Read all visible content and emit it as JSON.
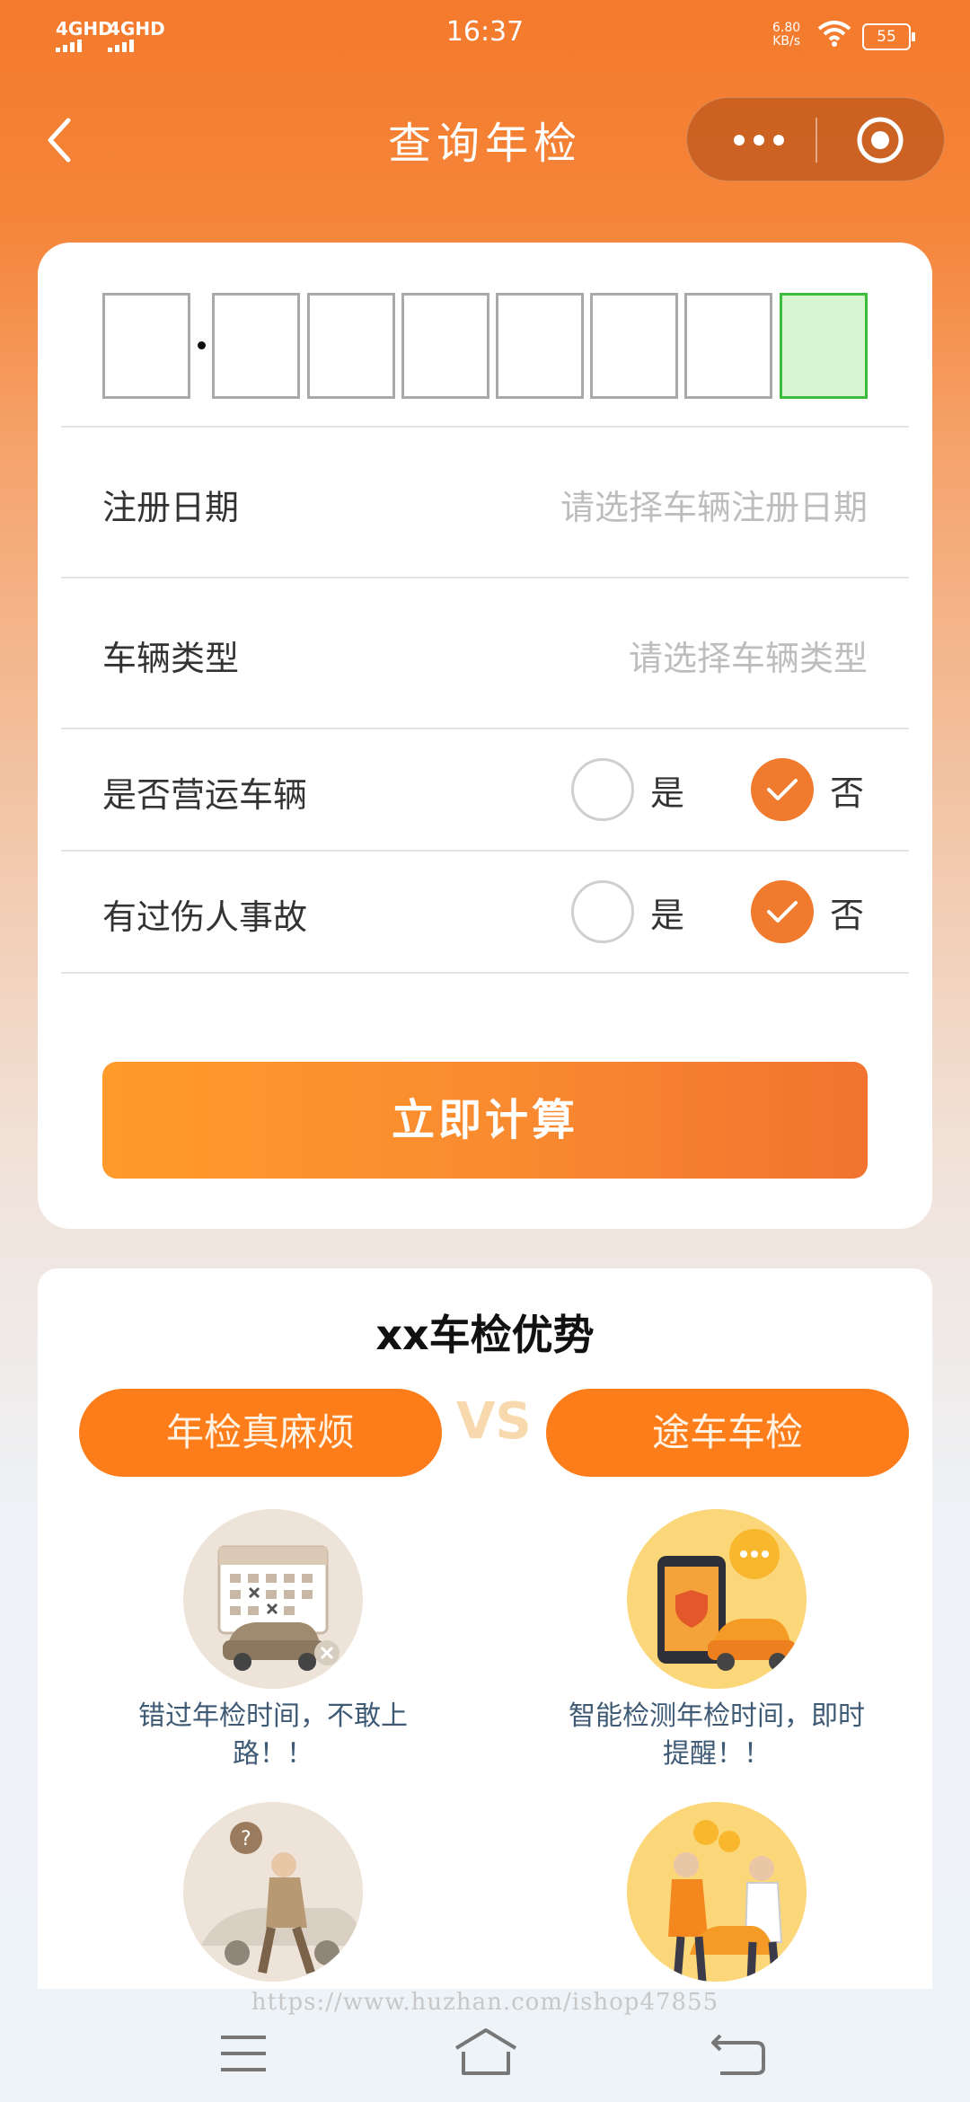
{
  "status_bar": {
    "signal_1": "4GHD",
    "signal_2": "4GHD",
    "time": "16:37",
    "net_speed_value": "6.80",
    "net_speed_unit": "KB/s",
    "battery": "55"
  },
  "nav": {
    "title": "查询年检"
  },
  "plate": {
    "box_count": 8,
    "highlight_index": 7
  },
  "form": {
    "reg_date": {
      "label": "注册日期",
      "placeholder": "请选择车辆注册日期"
    },
    "vehicle_type": {
      "label": "车辆类型",
      "placeholder": "请选择车辆类型"
    },
    "commercial": {
      "label": "是否营运车辆",
      "yes": "是",
      "no": "否",
      "selected": "否"
    },
    "accident": {
      "label": "有过伤人事故",
      "yes": "是",
      "no": "否",
      "selected": "否"
    },
    "submit_label": "立即计算"
  },
  "advantages": {
    "title": "xx车检优势",
    "left_pill": "年检真麻烦",
    "vs": "VS",
    "right_pill": "途车车检",
    "items": [
      {
        "caption_1": "错过年检时间，不敢上",
        "caption_2": "路！！"
      },
      {
        "caption_1": "智能检测年检时间，即时",
        "caption_2": "提醒！！"
      }
    ]
  },
  "watermark": "https://www.huzhan.com/ishop47855",
  "colors": {
    "accent": "#f07a2e",
    "button_start": "#ff9a2b",
    "button_end": "#f1732f",
    "plate_highlight": "#d7f5d0"
  }
}
